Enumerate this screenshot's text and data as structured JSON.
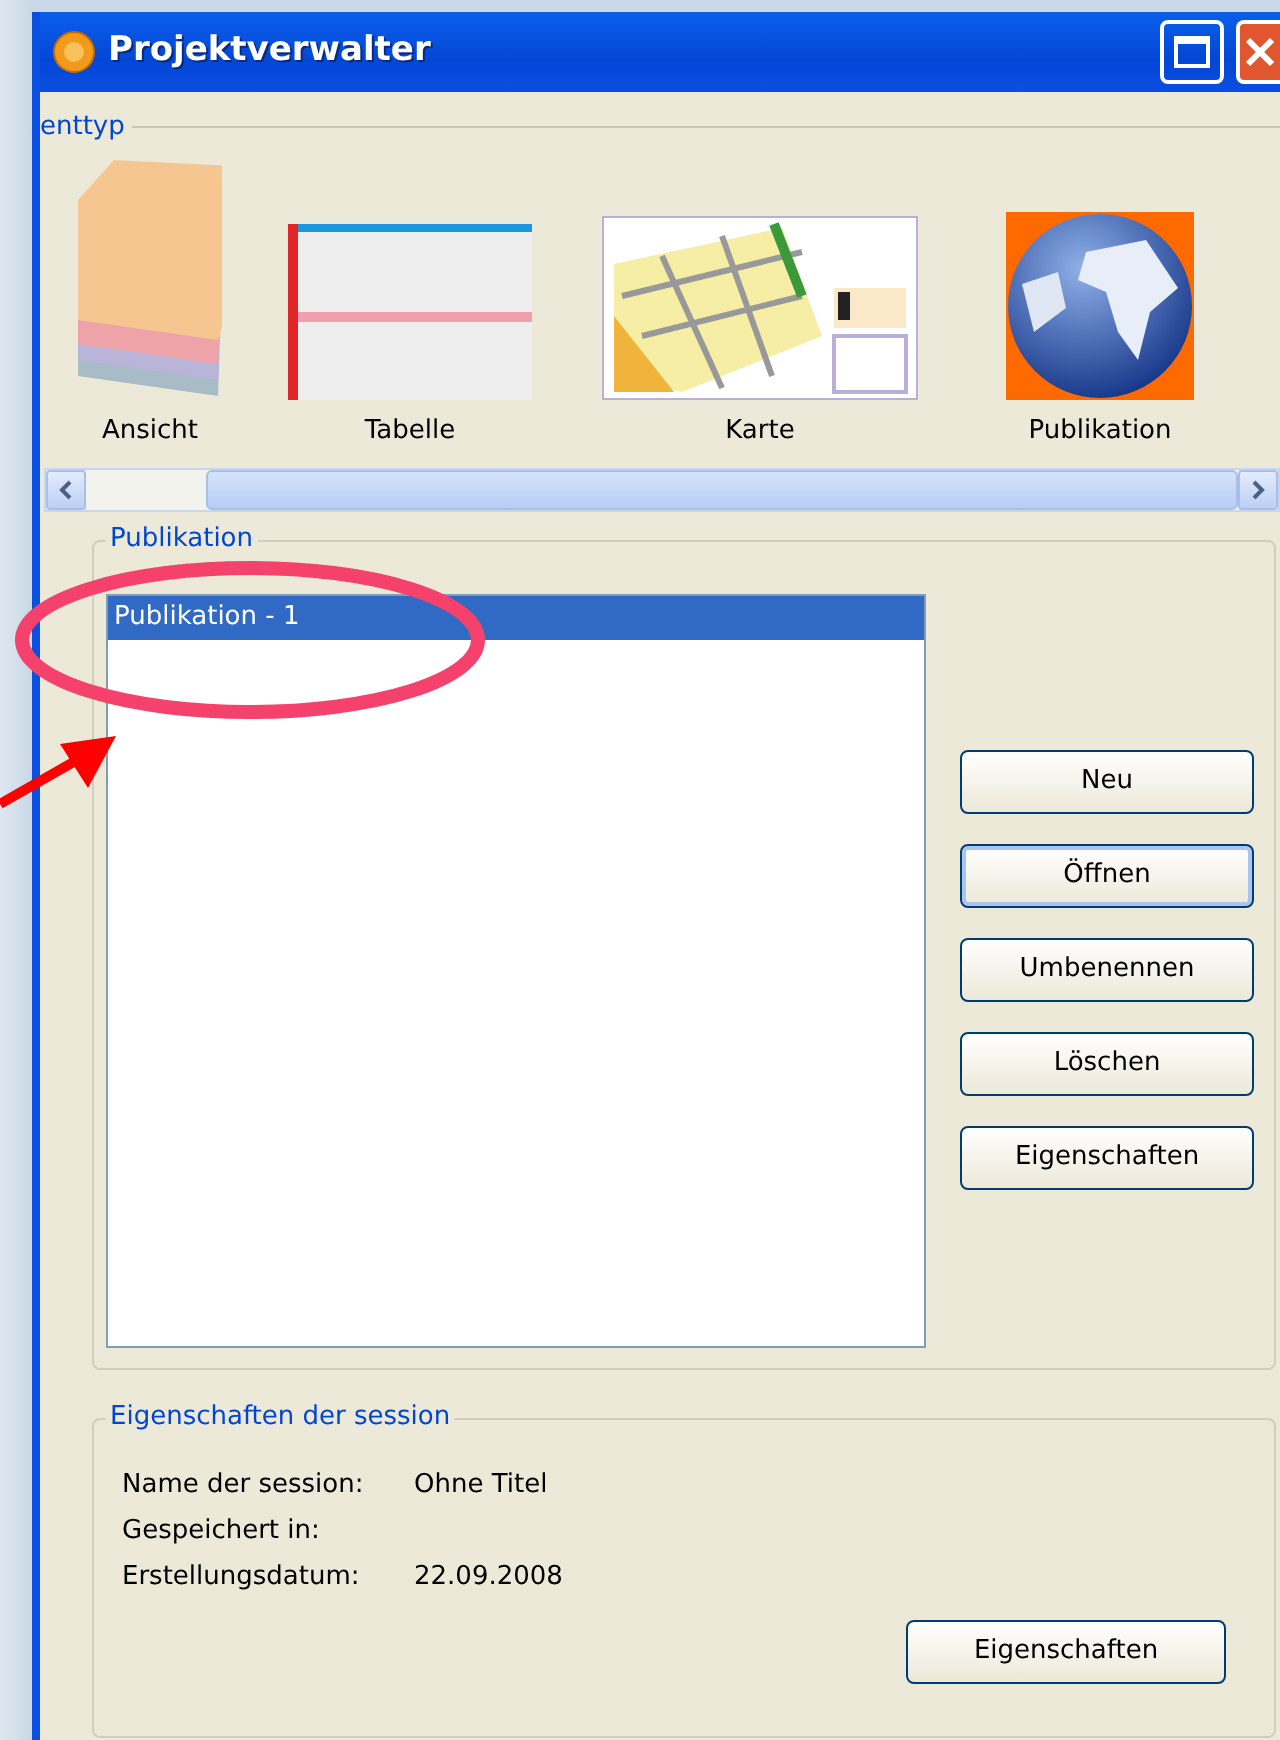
{
  "window": {
    "title": "Projektverwalter"
  },
  "type_group": {
    "legend": "enttyp",
    "items": [
      {
        "kind": "layers",
        "label": "Ansicht"
      },
      {
        "kind": "table",
        "label": "Tabelle"
      },
      {
        "kind": "map",
        "label": "Karte"
      },
      {
        "kind": "globe",
        "label": "Publikation"
      }
    ]
  },
  "publication_group": {
    "legend": "Publikation",
    "items": [
      {
        "label": "Publikation - 1",
        "selected": true
      }
    ],
    "buttons": [
      {
        "label": "Neu",
        "focused": false
      },
      {
        "label": "Öffnen",
        "focused": true
      },
      {
        "label": "Umbenennen",
        "focused": false
      },
      {
        "label": "Löschen",
        "focused": false
      },
      {
        "label": "Eigenschaften",
        "focused": false
      }
    ]
  },
  "session_group": {
    "legend": "Eigenschaften der session",
    "fields": [
      {
        "label": "Name der session:",
        "value": "Ohne Titel"
      },
      {
        "label": "Gespeichert in:"
      },
      {
        "label": "Erstellungsdatum:",
        "value": "22.09.2008"
      }
    ],
    "button": "Eigenschaften"
  }
}
